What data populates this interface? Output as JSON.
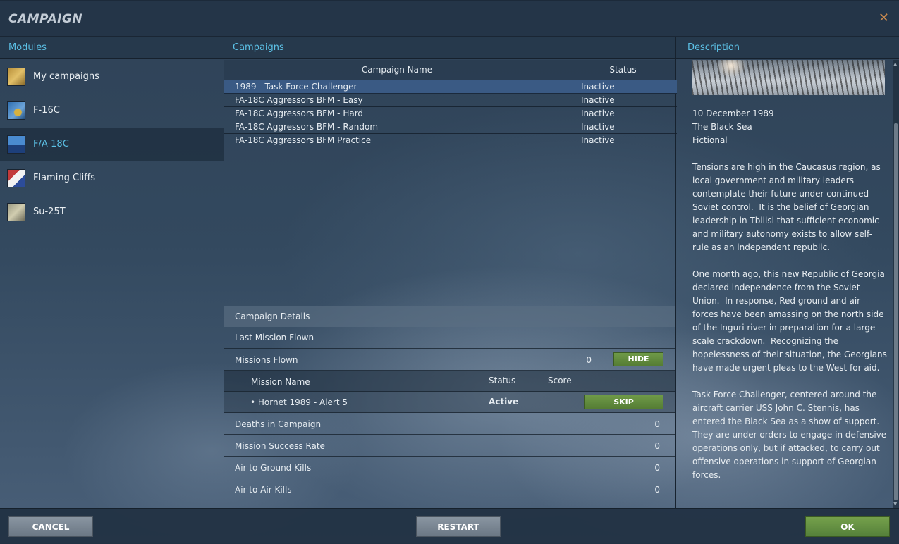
{
  "window": {
    "title": "CAMPAIGN",
    "close_glyph": "✕"
  },
  "columns": {
    "modules": "Modules",
    "campaigns": "Campaigns",
    "description": "Description"
  },
  "modules": [
    {
      "label": "My campaigns",
      "icon": "my-campaigns-icon"
    },
    {
      "label": "F-16C",
      "icon": "f16c-module-icon"
    },
    {
      "label": "F/A-18C",
      "icon": "fa18c-module-icon",
      "selected": true
    },
    {
      "label": "Flaming Cliffs",
      "icon": "flaming-cliffs-icon"
    },
    {
      "label": "Su-25T",
      "icon": "su25t-module-icon"
    }
  ],
  "campaign_table": {
    "headers": {
      "name": "Campaign Name",
      "status": "Status"
    },
    "rows": [
      {
        "name": "1989 - Task Force Challenger",
        "status": "Inactive",
        "selected": true
      },
      {
        "name": "FA-18C Aggressors BFM - Easy",
        "status": "Inactive"
      },
      {
        "name": "FA-18C Aggressors BFM - Hard",
        "status": "Inactive"
      },
      {
        "name": "FA-18C Aggressors BFM - Random",
        "status": "Inactive"
      },
      {
        "name": "FA-18C Aggressors BFM Practice",
        "status": "Inactive"
      }
    ]
  },
  "details": {
    "header": "Campaign Details",
    "last_mission_flown": "Last Mission Flown",
    "missions_flown": {
      "label": "Missions Flown",
      "value": "0",
      "hide_button": "HIDE"
    },
    "missions_table": {
      "headers": {
        "name": "Mission Name",
        "status": "Status",
        "score": "Score"
      },
      "rows": [
        {
          "name": "• Hornet 1989 - Alert 5",
          "status": "Active",
          "score": "",
          "skip_button": "SKIP"
        }
      ]
    },
    "stats": [
      {
        "label": "Deaths in Campaign",
        "value": "0"
      },
      {
        "label": "Mission Success Rate",
        "value": "0"
      },
      {
        "label": "Air to Ground Kills",
        "value": "0"
      },
      {
        "label": "Air to Air Kills",
        "value": "0"
      }
    ]
  },
  "description": {
    "date": "10 December 1989",
    "location": "The Black Sea",
    "type": "Fictional",
    "paragraphs": [
      "Tensions are high in the Caucasus region, as local government and military leaders contemplate their future under continued Soviet control.  It is the belief of Georgian leadership in Tbilisi that sufficient economic and military autonomy exists to allow self-rule as an independent republic.",
      "One month ago, this new Republic of Georgia declared independence from the Soviet Union.  In response, Red ground and air forces have been amassing on the north side of the Inguri river in preparation for a large-scale crackdown.  Recognizing the hopelessness of their situation, the Georgians have made urgent pleas to the West for aid.",
      "Task Force Challenger, centered around the aircraft carrier USS John C. Stennis, has entered the Black Sea as a show of support. They are under orders to engage in defensive operations only, but if attacked, to carry out offensive operations in support of Georgian forces."
    ]
  },
  "footer": {
    "cancel": "CANCEL",
    "restart": "RESTART",
    "ok": "OK"
  },
  "colors": {
    "accent": "#5cc1e6",
    "selection": "#3a5a84",
    "ok_green": "#6b9a45",
    "close": "#c8894f"
  }
}
